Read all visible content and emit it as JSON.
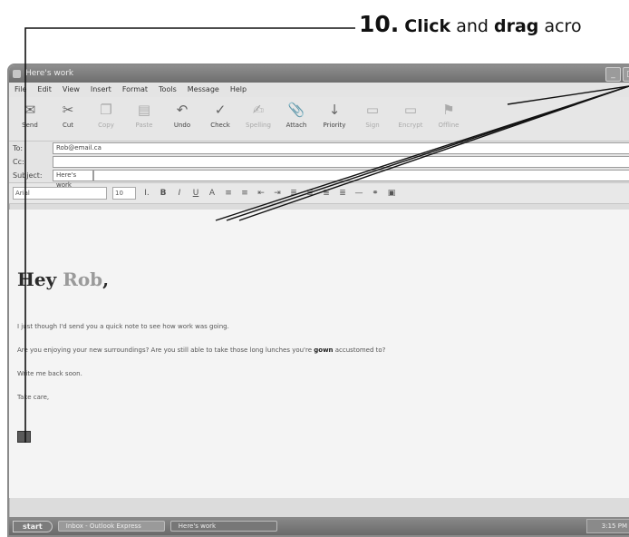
{
  "callout": {
    "step_number": "10.",
    "word_click": "Click",
    "word_and": "and",
    "word_drag": "drag",
    "word_rest": "acro"
  },
  "window": {
    "title": "Here's work",
    "menu": [
      "File",
      "Edit",
      "View",
      "Insert",
      "Format",
      "Tools",
      "Message",
      "Help"
    ],
    "toolbar": [
      {
        "label": "Send",
        "icon": "send-icon",
        "glyph": "✉"
      },
      {
        "label": "Cut",
        "icon": "cut-icon",
        "glyph": "✂"
      },
      {
        "label": "Copy",
        "icon": "copy-icon",
        "glyph": "❐"
      },
      {
        "label": "Paste",
        "icon": "paste-icon",
        "glyph": "▤"
      },
      {
        "label": "Undo",
        "icon": "undo-icon",
        "glyph": "↶"
      },
      {
        "label": "Check",
        "icon": "check-icon",
        "glyph": "✓"
      },
      {
        "label": "Spelling",
        "icon": "spelling-icon",
        "glyph": "✍"
      },
      {
        "label": "Attach",
        "icon": "attach-icon",
        "glyph": "📎"
      },
      {
        "label": "Priority",
        "icon": "priority-icon",
        "glyph": "↓"
      },
      {
        "label": "Sign",
        "icon": "sign-icon",
        "glyph": "▭"
      },
      {
        "label": "Encrypt",
        "icon": "encrypt-icon",
        "glyph": "▭"
      },
      {
        "label": "Offline",
        "icon": "offline-icon",
        "glyph": "⚑"
      }
    ],
    "to_label": "To:",
    "to_value": "Rob@email.ca",
    "cc_label": "Cc:",
    "cc_value": "",
    "subject_label": "Subject:",
    "subject_value": "Here's work",
    "font_name": "Arial",
    "font_size": "10"
  },
  "message": {
    "greeting_word": "Hey",
    "greeting_name": "Rob",
    "greeting_punct": ",",
    "line1": "I just though I'd send you a quick note to see how work was going.",
    "line2_before": "Are you enjoying your new surroundings?  Are you still able to take those long lunches you're ",
    "line2_bold": "gown",
    "line2_after": " accustomed to?",
    "line3": "Write me back soon.",
    "line4": "Take care,"
  },
  "taskbar": {
    "start_label": "start",
    "task1": "Inbox - Outlook Express",
    "task2": "Here's work",
    "clock": "3:15 PM"
  }
}
